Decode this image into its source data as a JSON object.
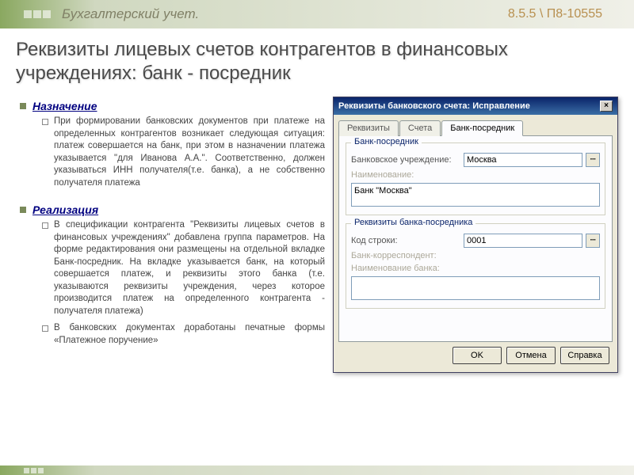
{
  "header": {
    "category": "Бухгалтерский учет.",
    "version": "8.5.5 \\ П8-10555"
  },
  "slide": {
    "title": "Реквизиты лицевых счетов контрагентов в финансовых учреждениях: банк - посредник"
  },
  "sections": {
    "purpose": {
      "heading": "Назначение",
      "text": "При формировании банковских документов при платеже на определенных контрагентов возникает следующая ситуация: платеж совершается на банк, при этом в назначении платежа указывается \"для Иванова А.А.\". Соответственно, должен указываться ИНН получателя(т.е. банка), а не собственно получателя платежа"
    },
    "impl": {
      "heading": "Реализация",
      "items": [
        "В спецификации контрагента \"Реквизиты лицевых счетов в финансовых учреждениях\" добавлена группа параметров. На форме редактирования они размещены на отдельной вкладке Банк-посредник. На вкладке указывается банк, на который совершается платеж, и реквизиты этого банка (т.е. указываются реквизиты учреждения, через которое производится платеж на определенного контрагента - получателя платежа)",
        "В банковских документах доработаны печатные формы «Платежное поручение»"
      ]
    }
  },
  "dialog": {
    "title": "Реквизиты банковского счета: Исправление",
    "tabs": {
      "t1": "Реквизиты",
      "t2": "Счета",
      "t3": "Банк-посредник"
    },
    "group1": {
      "title": "Банк-посредник",
      "bank_label": "Банковское учреждение:",
      "bank_value": "Москва",
      "name_label": "Наименование:",
      "name_value": "Банк \"Москва\""
    },
    "group2": {
      "title": "Реквизиты банка-посредника",
      "code_label": "Код строки:",
      "code_value": "0001",
      "corr_label": "Банк-корреспондент:",
      "corr_name_label": "Наименование банка:"
    },
    "buttons": {
      "ok": "OK",
      "cancel": "Отмена",
      "help": "Справка"
    }
  }
}
